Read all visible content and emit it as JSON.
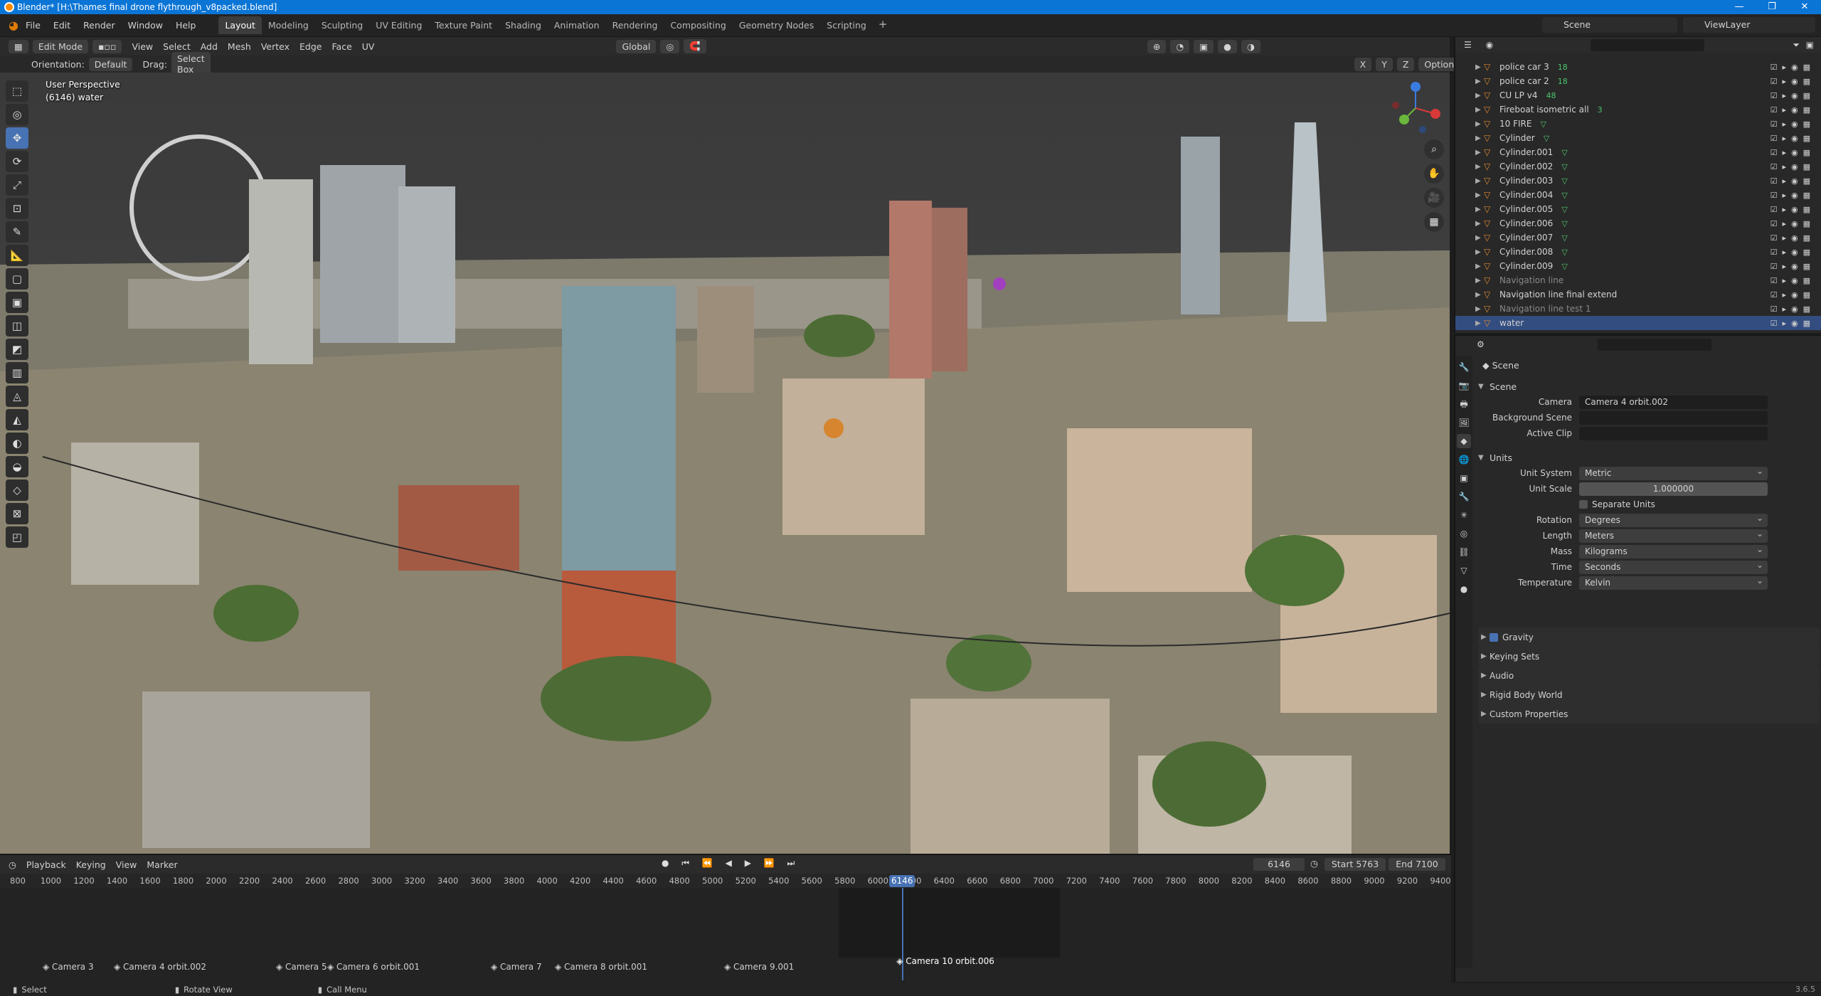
{
  "window": {
    "title": "Blender* [H:\\Thames final drone flythrough_v8packed.blend]",
    "controls": [
      "—",
      "❐",
      "✕"
    ]
  },
  "menu": [
    "File",
    "Edit",
    "Render",
    "Window",
    "Help"
  ],
  "workspaces": [
    "Layout",
    "Modeling",
    "Sculpting",
    "UV Editing",
    "Texture Paint",
    "Shading",
    "Animation",
    "Rendering",
    "Compositing",
    "Geometry Nodes",
    "Scripting",
    "+"
  ],
  "scene_selector": "Scene",
  "viewlayer_selector": "ViewLayer",
  "viewport_header": {
    "mode": "Edit Mode",
    "menus": [
      "View",
      "Select",
      "Add",
      "Mesh",
      "Vertex",
      "Edge",
      "Face",
      "UV"
    ],
    "transform": "Global",
    "orientation_label": "Orientation:",
    "orientation_value": "Default",
    "drag_label": "Drag:",
    "drag_value": "Select Box",
    "axes": [
      "X",
      "Y",
      "Z"
    ],
    "options": "Options"
  },
  "viewport_info": {
    "line1": "User Perspective",
    "line2": "(6146) water"
  },
  "toolbar_tools": [
    "select-icon",
    "cursor-icon",
    "move-icon",
    "rotate-icon",
    "scale-icon",
    "transform-icon",
    "annotate-icon",
    "measure-icon",
    "add-cube-icon",
    "extrude-icon",
    "inset-icon",
    "bevel-icon",
    "loop-cut-icon",
    "knife-icon",
    "poly-build-icon",
    "spin-icon",
    "smooth-icon",
    "slide-icon",
    "shrink-icon",
    "shear-icon",
    "rip-icon"
  ],
  "outliner": {
    "rows": [
      {
        "name": "police car 3",
        "sub": "18",
        "dim": false
      },
      {
        "name": "police car 2",
        "sub": "18",
        "dim": false
      },
      {
        "name": "CU LP v4",
        "sub": "48",
        "dim": false
      },
      {
        "name": "Fireboat isometric all",
        "sub": "3",
        "dim": false
      },
      {
        "name": "10 FIRE",
        "sub": "▽",
        "dim": false
      },
      {
        "name": "Cylinder",
        "sub": "▽",
        "dim": false
      },
      {
        "name": "Cylinder.001",
        "sub": "▽",
        "dim": false
      },
      {
        "name": "Cylinder.002",
        "sub": "▽",
        "dim": false
      },
      {
        "name": "Cylinder.003",
        "sub": "▽",
        "dim": false
      },
      {
        "name": "Cylinder.004",
        "sub": "▽",
        "dim": false
      },
      {
        "name": "Cylinder.005",
        "sub": "▽",
        "dim": false
      },
      {
        "name": "Cylinder.006",
        "sub": "▽",
        "dim": false
      },
      {
        "name": "Cylinder.007",
        "sub": "▽",
        "dim": false
      },
      {
        "name": "Cylinder.008",
        "sub": "▽",
        "dim": false
      },
      {
        "name": "Cylinder.009",
        "sub": "▽",
        "dim": false
      },
      {
        "name": "Navigation line",
        "sub": "",
        "dim": true
      },
      {
        "name": "Navigation line final extend",
        "sub": "",
        "dim": false
      },
      {
        "name": "Navigation line test 1",
        "sub": "",
        "dim": true
      },
      {
        "name": "water",
        "sub": "",
        "dim": false,
        "selected": true
      }
    ]
  },
  "properties": {
    "breadcrumb": "Scene",
    "scene_panel": {
      "title": "Scene",
      "camera_label": "Camera",
      "camera_value": "Camera 4 orbit.002",
      "bg_label": "Background Scene",
      "bg_value": "",
      "clip_label": "Active Clip",
      "clip_value": ""
    },
    "units_panel": {
      "title": "Units",
      "unit_system_label": "Unit System",
      "unit_system": "Metric",
      "unit_scale_label": "Unit Scale",
      "unit_scale": "1.000000",
      "separate_units": "Separate Units",
      "rotation_label": "Rotation",
      "rotation": "Degrees",
      "length_label": "Length",
      "length": "Meters",
      "mass_label": "Mass",
      "mass": "Kilograms",
      "time_label": "Time",
      "time": "Seconds",
      "temperature_label": "Temperature",
      "temperature": "Kelvin"
    },
    "collapsed_panels": [
      "Gravity",
      "Keying Sets",
      "Audio",
      "Rigid Body World",
      "Custom Properties"
    ]
  },
  "timeline": {
    "menus": [
      "Playback",
      "Keying",
      "View",
      "Marker"
    ],
    "current_frame": "6146",
    "start": "Start 5763",
    "end": "End 7100",
    "ticks": [
      "800",
      "1000",
      "1200",
      "1400",
      "1600",
      "1800",
      "2000",
      "2200",
      "2400",
      "2600",
      "2800",
      "3000",
      "3200",
      "3400",
      "3600",
      "3800",
      "4000",
      "4200",
      "4400",
      "4600",
      "4800",
      "5000",
      "5200",
      "5400",
      "5600",
      "5800",
      "6000",
      "6200",
      "6400",
      "6600",
      "6800",
      "7000",
      "7200",
      "7400",
      "7600",
      "7800",
      "8000",
      "8200",
      "8400",
      "8600",
      "8800",
      "9000",
      "9200",
      "9400"
    ],
    "markers": [
      "Camera 3",
      "Camera 4 orbit.002",
      "Camera 5",
      "Camera 6 orbit.001",
      "Camera 7",
      "Camera 8 orbit.001",
      "Camera 9.001",
      "Camera 10 orbit.006"
    ]
  },
  "statusbar": {
    "select": "Select",
    "rotate": "Rotate View",
    "menu": "Call Menu",
    "version": "3.6.5"
  },
  "colors": {
    "accent": "#4772b3",
    "title_bar": "#0b75d6",
    "selected_row": "#334d80"
  }
}
